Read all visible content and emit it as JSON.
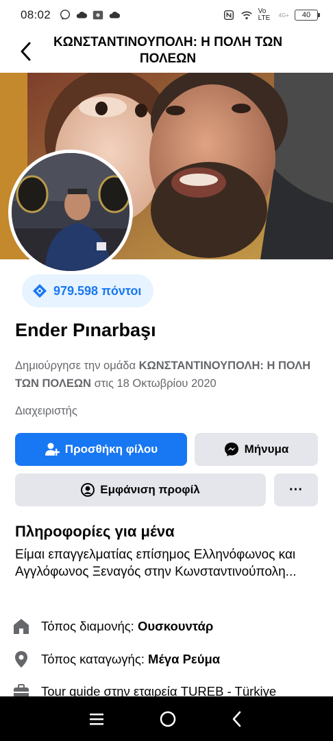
{
  "status": {
    "time": "08:02",
    "network": "Vo LTE",
    "signal": "4G+",
    "battery": "40"
  },
  "header": {
    "title": "ΚΩΝΣΤΑΝΤΙΝΟΥΠΟΛΗ: Η ΠΟΛΗ ΤΩΝ ΠΟΛΕΩΝ"
  },
  "profile": {
    "points": "979.598 πόντοι",
    "name": "Ender Pınarbaşı",
    "created_prefix": "Δημιούργησε την ομάδα",
    "group_name": "ΚΩΝΣΤΑΝΤΙΝΟΥΠΟΛΗ: Η ΠΟΛΗ ΤΩΝ ΠΟΛΕΩΝ",
    "created_suffix": "στις 18 Οκτωβρίου 2020",
    "role": "Διαχειριστής"
  },
  "actions": {
    "add_friend": "Προσθήκη φίλου",
    "message": "Μήνυμα",
    "view_profile": "Εμφάνιση προφίλ",
    "more": "···"
  },
  "about": {
    "title": "Πληροφορίες για μένα",
    "text": "Είμαι επαγγελματίας επίσημος Ελληνόφωνος και Αγγλόφωνος  Ξεναγός στην Κωνσταντινούπολη...",
    "items": [
      {
        "icon": "home-icon",
        "label": "Τόπος διαμονής:",
        "value": "Ουσκουντάρ"
      },
      {
        "icon": "location-pin-icon",
        "label": "Τόπος καταγωγής:",
        "value": "Μέγα Ρεύμα"
      },
      {
        "icon": "briefcase-icon",
        "label": "Tour guide στην εταιρεία TUREB - Türkiye",
        "value": ""
      }
    ]
  },
  "colors": {
    "accent": "#1877f2",
    "badge_bg": "#e7f3ff",
    "secondary_btn": "#e4e6eb",
    "muted_text": "#65676b"
  }
}
